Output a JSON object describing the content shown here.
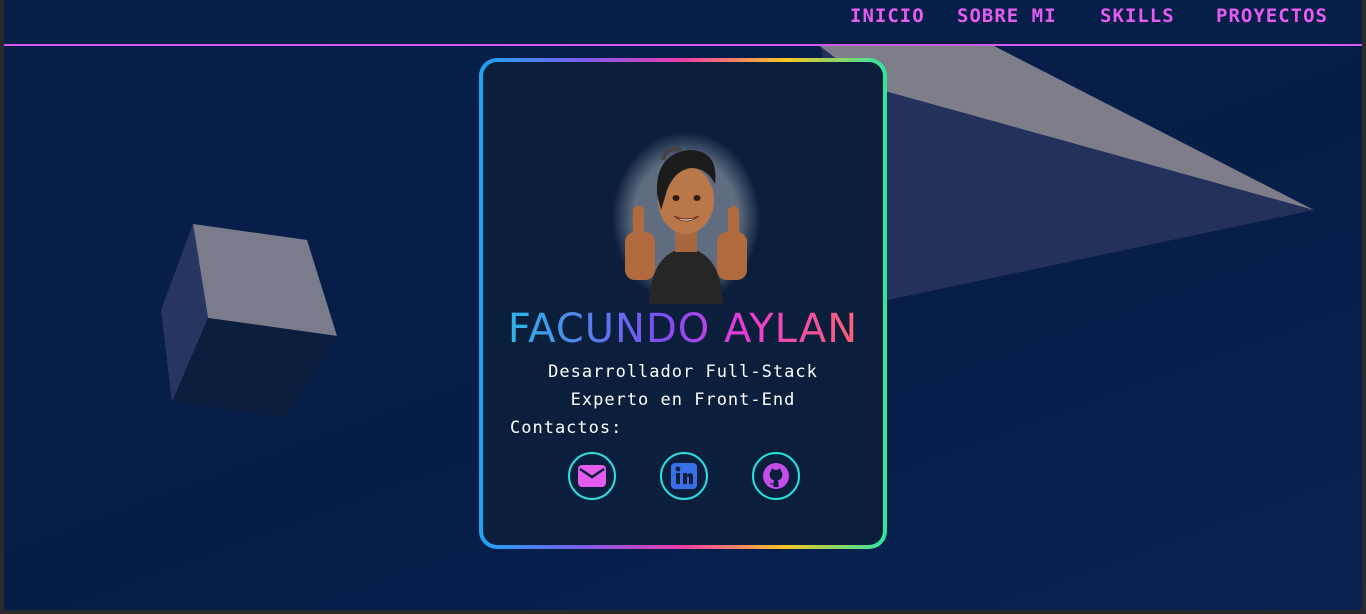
{
  "nav": {
    "items": [
      "INICIO",
      "SOBRE MI",
      "SKILLS",
      "PROYECTOS"
    ]
  },
  "profile": {
    "name": "FACUNDO AYLAN",
    "role_line1": "Desarrollador Full-Stack",
    "role_line2": "Experto en Front-End",
    "contacts_label": "Contactos:"
  },
  "social": {
    "email_icon": "envelope-icon",
    "linkedin_icon": "linkedin-icon",
    "github_icon": "github-icon"
  },
  "colors": {
    "nav_accent": "#e55cf0",
    "icon_ring": "#28e0de",
    "email_icon": "#e55cf0",
    "linkedin_icon": "#3b6fe8",
    "github_icon": "#c54de8"
  }
}
